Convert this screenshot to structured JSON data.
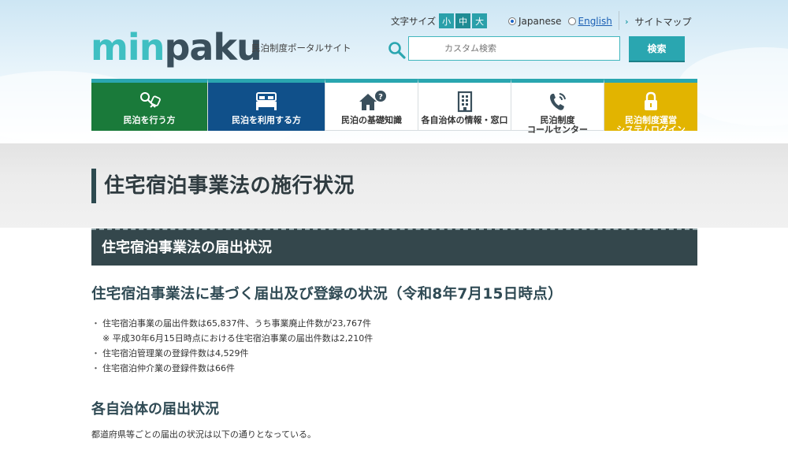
{
  "header": {
    "logo_part1": "min",
    "logo_part2": "paku",
    "tagline": "民泊制度ポータルサイト",
    "font_size_label": "文字サイズ",
    "font_sizes": [
      "小",
      "中",
      "大"
    ],
    "languages": [
      {
        "label": "Japanese",
        "checked": true
      },
      {
        "label": "English",
        "checked": false
      }
    ],
    "sitemap_label": "サイトマップ",
    "search": {
      "placeholder": "カスタム検索",
      "button_label": "検索"
    }
  },
  "nav": {
    "items": [
      {
        "label": "民泊を行う方",
        "icon": "keys-icon"
      },
      {
        "label": "民泊を利用する方",
        "icon": "bed-icon"
      },
      {
        "label": "民泊の基礎知識",
        "icon": "house-question-icon"
      },
      {
        "label": "各自治体の情報・窓口",
        "icon": "building-icon"
      },
      {
        "label_line1": "民泊制度",
        "label_line2": "コールセンター",
        "icon": "phone-icon"
      },
      {
        "label_line1": "民泊制度運営",
        "label_line2": "システムログイン",
        "icon": "lock-icon"
      }
    ]
  },
  "page": {
    "title": "住宅宿泊事業法の施行状況",
    "section_title": "住宅宿泊事業法の届出状況",
    "heading": "住宅宿泊事業法に基づく届出及び登録の状況（令和8年7月15日時点）",
    "bullets": [
      "住宅宿泊事業の届出件数は65,837件、うち事業廃止件数が23,767件",
      "住宅宿泊管理業の登録件数は4,529件",
      "住宅宿泊仲介業の登録件数は66件"
    ],
    "note": "※ 平成30年6月15日時点における住宅宿泊事業の届出件数は2,210件",
    "subheading": "各自治体の届出状況",
    "paragraph": "都道府県等ごとの届出の状況は以下の通りとなっている。"
  },
  "colors": {
    "teal": "#2aa6b0",
    "green_tile": "#1a7a3a",
    "blue_tile": "#10508a",
    "yellow_tile": "#e2b400",
    "section_bar": "#34474c"
  }
}
